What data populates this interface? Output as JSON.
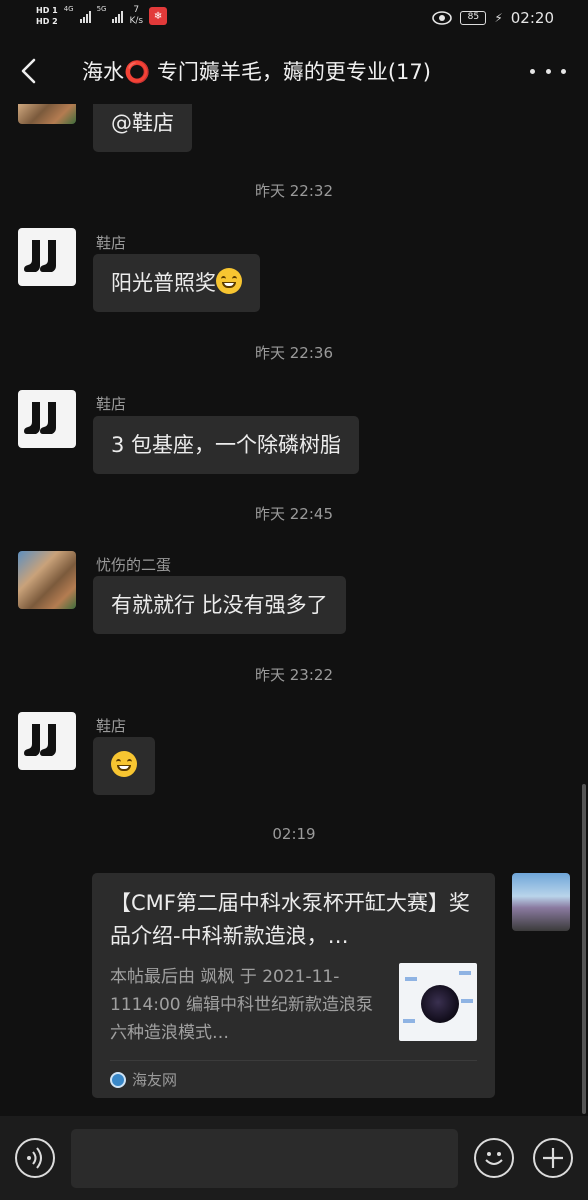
{
  "status_bar": {
    "hd1": "HD 1",
    "hd2": "HD 2",
    "sig1_label": "4G",
    "sig2_label": "5G",
    "net_speed_value": "7",
    "net_speed_unit": "K/s",
    "battery": "85",
    "time": "02:20"
  },
  "header": {
    "title": "海水⭕ 专门薅羊毛，薅的更专业(17)",
    "back_icon": "chevron-left-icon",
    "more_icon": "more-dots-icon"
  },
  "messages": [
    {
      "sender": "",
      "text": "@鞋店"
    },
    {
      "time": "昨天 22:32",
      "sender": "鞋店",
      "text": "阳光普照奖"
    },
    {
      "time": "昨天 22:36",
      "sender": "鞋店",
      "text": "3 包基座，一个除磷树脂"
    },
    {
      "time": "昨天 22:45",
      "sender": "忧伤的二蛋",
      "text": "有就就行 比没有强多了"
    },
    {
      "time": "昨天 23:22",
      "sender": "鞋店",
      "text": ""
    }
  ],
  "card": {
    "time": "02:19",
    "title": "【CMF第二届中科水泵杯开缸大赛】奖品介绍-中科新款造浪，…",
    "desc": "本帖最后由 飒枫 于 2021-11-1114:00 编辑中科世纪新款造浪泵六种造浪模式…",
    "source": "海友网"
  },
  "input": {
    "placeholder": ""
  },
  "colors": {
    "background": "#111111",
    "bubble": "#2c2c2c",
    "muted_text": "#9a9a9a"
  }
}
